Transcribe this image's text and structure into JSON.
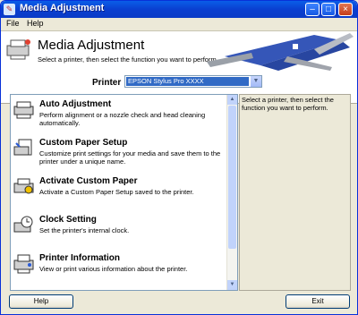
{
  "window": {
    "title": "Media Adjustment",
    "minimize_label": "–",
    "maximize_label": "□",
    "close_label": "×"
  },
  "menu": {
    "items": [
      "File",
      "Help"
    ]
  },
  "header": {
    "title": "Media Adjustment",
    "subtitle": "Select a printer, then select the function you want to perform."
  },
  "printer": {
    "label": "Printer",
    "selected": "EPSON Stylus Pro XXXX"
  },
  "functions": [
    {
      "title": "Auto Adjustment",
      "desc": "Perform alignment or a nozzle check and head cleaning automatically.",
      "icon": "printer-head-icon"
    },
    {
      "title": "Custom Paper Setup",
      "desc": "Customize print settings for your media and save them to the printer under a unique name.",
      "icon": "paper-setup-icon"
    },
    {
      "title": "Activate Custom Paper",
      "desc": "Activate a Custom Paper Setup saved to the printer.",
      "icon": "activate-paper-icon"
    },
    {
      "title": "Clock Setting",
      "desc": "Set the printer's internal clock.",
      "icon": "clock-icon"
    },
    {
      "title": "Printer Information",
      "desc": "View or print various information about the printer.",
      "icon": "printer-info-icon"
    }
  ],
  "description": {
    "text": "Select a printer, then select the function you want to perform."
  },
  "buttons": {
    "help": "Help",
    "exit": "Exit"
  }
}
